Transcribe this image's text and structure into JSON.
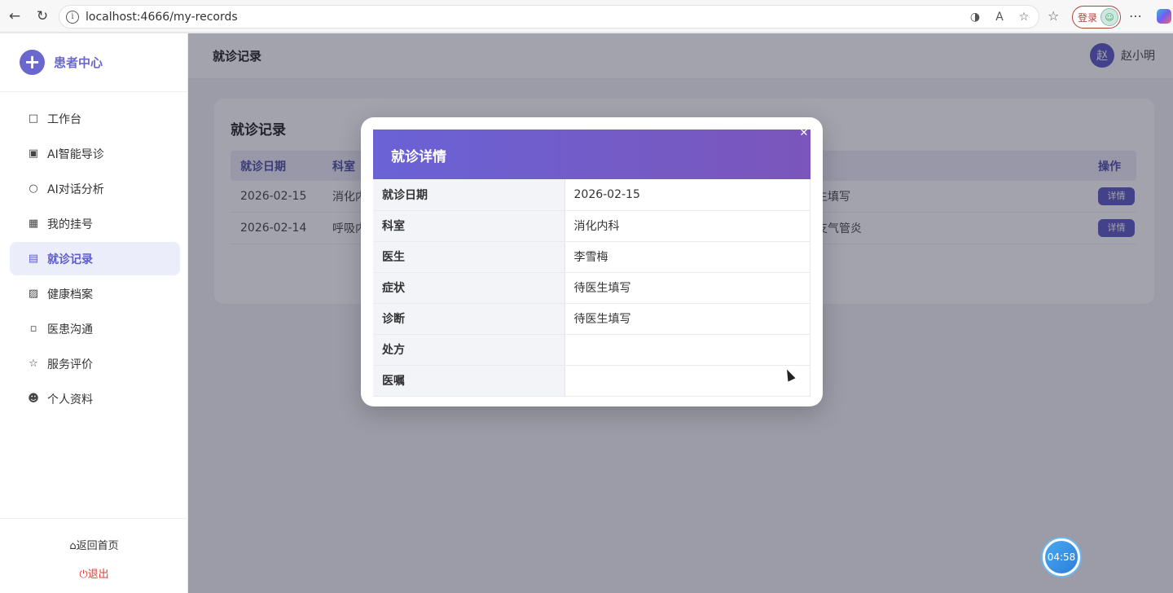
{
  "browser": {
    "url": "localhost:4666/my-records",
    "login_label": "登录"
  },
  "sidebar": {
    "brand": "患者中心",
    "items": [
      {
        "label": "工作台",
        "icon": "monitor-icon"
      },
      {
        "label": "AI智能导诊",
        "icon": "chip-icon"
      },
      {
        "label": "AI对话分析",
        "icon": "chat-icon"
      },
      {
        "label": "我的挂号",
        "icon": "calendar-icon"
      },
      {
        "label": "就诊记录",
        "icon": "document-icon",
        "active": true
      },
      {
        "label": "健康档案",
        "icon": "chart-board-icon"
      },
      {
        "label": "医患沟通",
        "icon": "message-icon"
      },
      {
        "label": "服务评价",
        "icon": "star-icon"
      },
      {
        "label": "个人资料",
        "icon": "user-icon"
      }
    ],
    "back_home": "返回首页",
    "logout": "退出"
  },
  "header": {
    "title": "就诊记录",
    "user_avatar": "赵",
    "user_name": "赵小明"
  },
  "records": {
    "title": "就诊记录",
    "columns": [
      "就诊日期",
      "科室",
      "操作"
    ],
    "rows": [
      {
        "date": "2026-02-15",
        "dept": "消化内",
        "mid": "生填写",
        "action": "详情"
      },
      {
        "date": "2026-02-14",
        "dept": "呼吸内",
        "mid": "支气管炎",
        "action": "详情"
      }
    ]
  },
  "modal": {
    "title": "就诊详情",
    "rows": [
      {
        "label": "就诊日期",
        "value": "2026-02-15"
      },
      {
        "label": "科室",
        "value": "消化内科"
      },
      {
        "label": "医生",
        "value": "李雪梅"
      },
      {
        "label": "症状",
        "value": "待医生填写"
      },
      {
        "label": "诊断",
        "value": "待医生填写"
      },
      {
        "label": "处方",
        "value": ""
      },
      {
        "label": "医嘱",
        "value": ""
      }
    ]
  },
  "timer": "04:58",
  "colors": {
    "accent": "#6a67ce",
    "modal_gradient_start": "#6a62d6",
    "modal_gradient_end": "#7b56bb",
    "logout": "#e0413a"
  }
}
